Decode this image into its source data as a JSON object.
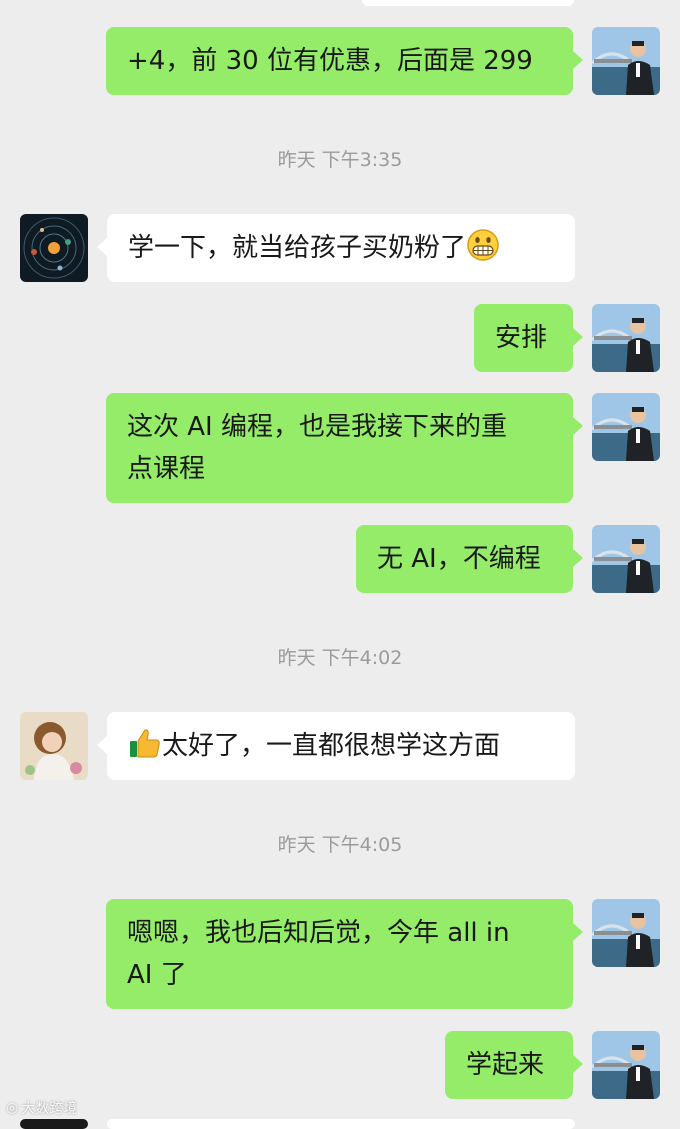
{
  "messages": [
    {
      "side": "me",
      "avatar": "photo-avatar",
      "text": "+4，前 30 位有优惠，后面是 299"
    },
    {
      "timestamp": "昨天 下午3:35"
    },
    {
      "side": "other",
      "avatar": "solar-system-avatar",
      "text": "学一下，就当给孩子买奶粉了",
      "emoji": "grinning-face-icon"
    },
    {
      "side": "me",
      "avatar": "photo-avatar",
      "text": "安排"
    },
    {
      "side": "me",
      "avatar": "photo-avatar",
      "lines": [
        "这次 AI 编程，也是我接下来的重",
        "点课程"
      ]
    },
    {
      "side": "me",
      "avatar": "photo-avatar",
      "text": "无 AI，不编程"
    },
    {
      "timestamp": "昨天 下午4:02"
    },
    {
      "side": "other",
      "avatar": "girl-avatar",
      "emoji": "thumbs-up-icon",
      "text": "太好了，一直都很想学这方面"
    },
    {
      "timestamp": "昨天 下午4:05"
    },
    {
      "side": "me",
      "avatar": "photo-avatar",
      "lines": [
        "嗯嗯，我也后知后觉，今年 all in",
        "AI 了"
      ]
    },
    {
      "side": "me",
      "avatar": "photo-avatar",
      "text": "学起来"
    }
  ],
  "watermark": "大数跨境",
  "colors": {
    "background": "#ededed",
    "my_bubble": "#95ec69",
    "other_bubble": "#ffffff",
    "timestamp": "#9b9b9b"
  }
}
